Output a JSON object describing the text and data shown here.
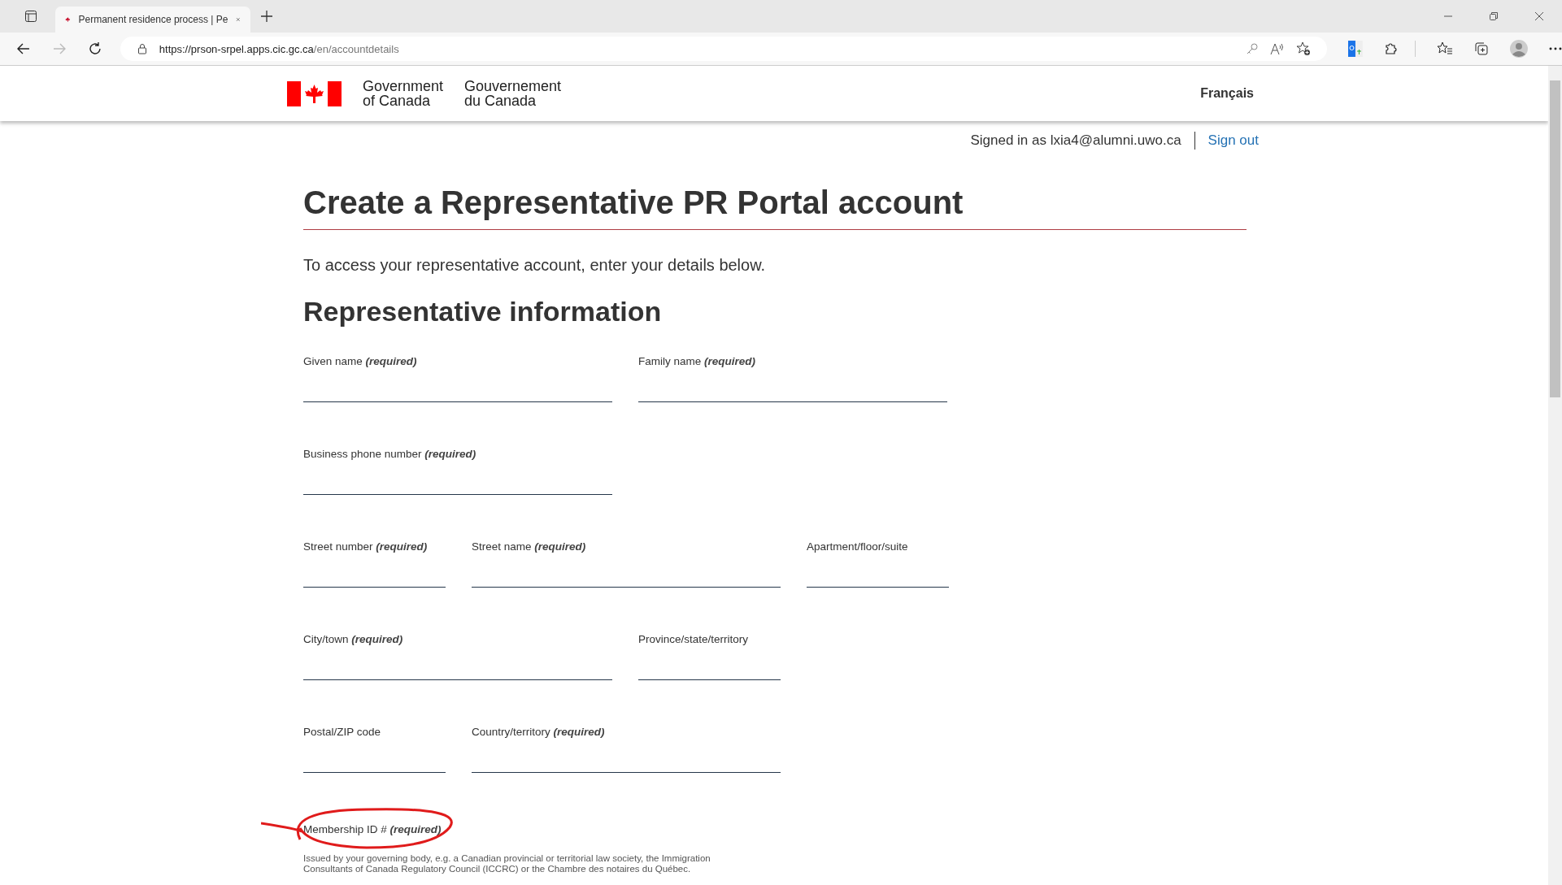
{
  "browser": {
    "tab_title": "Permanent residence process | Pe",
    "url_host": "https://prson-srpel.apps.cic.gc.ca",
    "url_path": "/en/accountdetails"
  },
  "header": {
    "wordmark_en": [
      "Government",
      "of Canada"
    ],
    "wordmark_fr": [
      "Gouvernement",
      "du Canada"
    ],
    "language_link": "Français"
  },
  "account": {
    "signed_in": "Signed in as lxia4@alumni.uwo.ca",
    "sign_out": "Sign out"
  },
  "title": "Create a Representative PR Portal account",
  "intro": "To access your representative account, enter your details below.",
  "section": "Representative information",
  "rows": [
    [
      {
        "label": "Given name",
        "note": "(required)"
      },
      {
        "label": "Family name",
        "note": "(required)"
      }
    ],
    [
      {
        "label": "Business phone number",
        "note": "(required)"
      }
    ],
    [
      {
        "label": "Street number",
        "note": "(required)"
      },
      {
        "label": "Street name",
        "note": "(required)"
      },
      {
        "label": "Apartment/floor/suite"
      }
    ],
    [
      {
        "label": "City/town",
        "note": "(required)"
      },
      {
        "label": "Province/state/territory"
      }
    ],
    [
      {
        "label": "Postal/ZIP code"
      },
      {
        "label": "Country/territory",
        "note": "(required)"
      }
    ]
  ],
  "membership": {
    "label": "Membership ID #",
    "note": "(required)",
    "help": "Issued by your governing body, e.g. a Canadian provincial or territorial law society, the Immigration Consultants of Canada Regulatory Council (ICCRC) or the Chambre des notaires du Québec."
  }
}
